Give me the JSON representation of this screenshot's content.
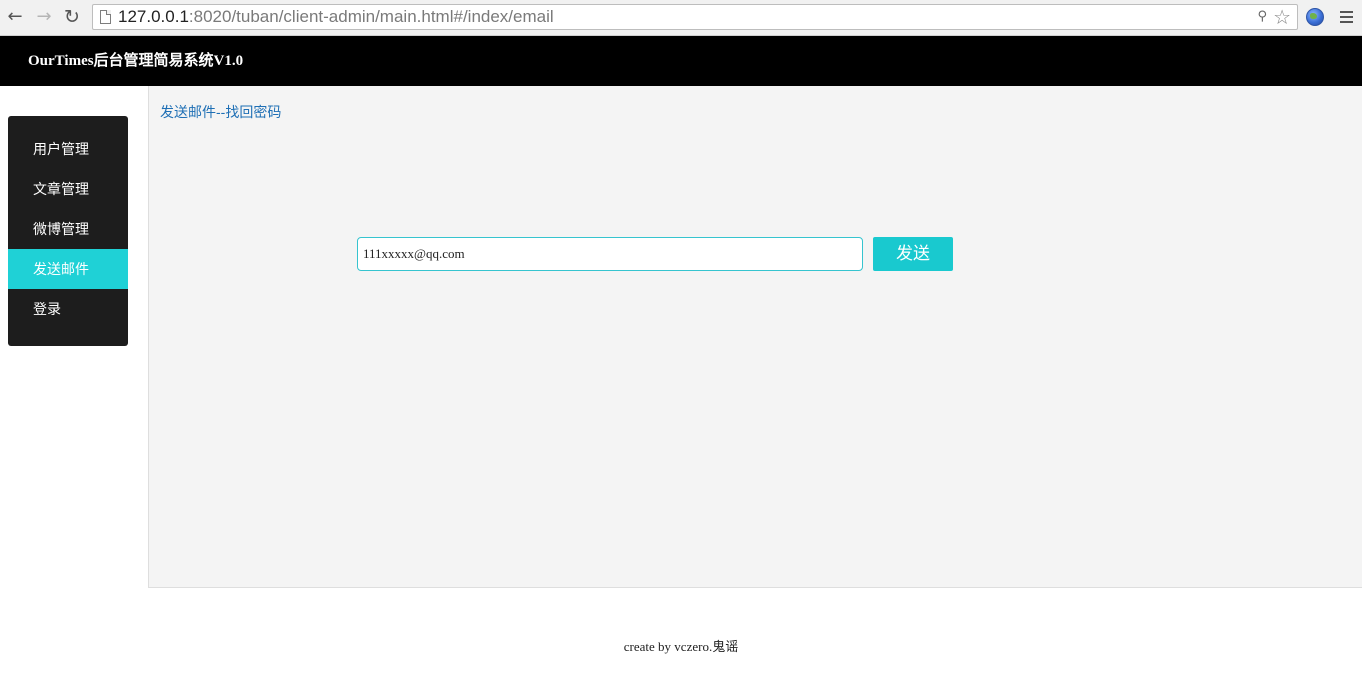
{
  "browser": {
    "url_host": "127.0.0.1",
    "url_rest": ":8020/tuban/client-admin/main.html#/index/email",
    "icons": [
      "back-arrow-icon",
      "forward-arrow-icon",
      "reload-icon",
      "page-icon",
      "key-icon",
      "star-icon",
      "globe-icon",
      "menu-icon"
    ]
  },
  "header": {
    "title": "OurTimes后台管理简易系统V1.0"
  },
  "sidebar": {
    "items": [
      {
        "label": "用户管理",
        "active": false
      },
      {
        "label": "文章管理",
        "active": false
      },
      {
        "label": "微博管理",
        "active": false
      },
      {
        "label": "发送邮件",
        "active": true
      },
      {
        "label": "登录",
        "active": false
      }
    ],
    "active_color": "#1fd1d6"
  },
  "main": {
    "breadcrumb": "发送邮件--找回密码",
    "email_input_value": "111xxxxx@qq.com",
    "send_button_label": "发送"
  },
  "footer": {
    "text": "create by vczero.鬼谣"
  },
  "colors": {
    "header_bg": "#000000",
    "sidebar_bg": "#1d1d1d",
    "accent": "#19c9cf",
    "link": "#1e6fb5",
    "panel_bg": "#f4f4f4"
  }
}
